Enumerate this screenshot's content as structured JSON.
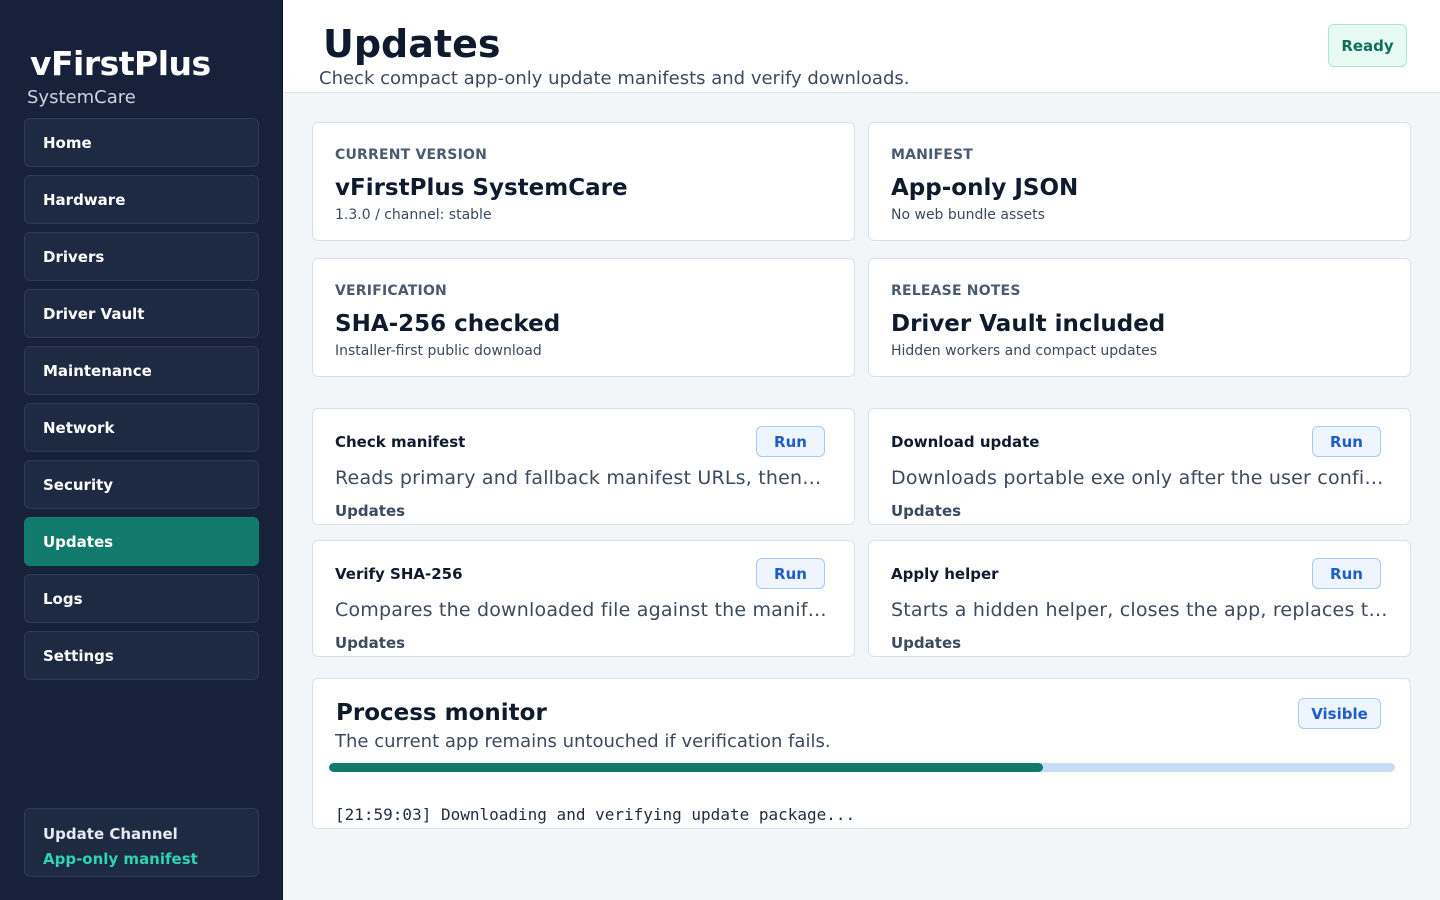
{
  "sidebar": {
    "brand": "vFirstPlus",
    "brand_sub": "SystemCare",
    "items": [
      {
        "label": "Home"
      },
      {
        "label": "Hardware"
      },
      {
        "label": "Drivers"
      },
      {
        "label": "Driver Vault"
      },
      {
        "label": "Maintenance"
      },
      {
        "label": "Network"
      },
      {
        "label": "Security"
      },
      {
        "label": "Updates"
      },
      {
        "label": "Logs"
      },
      {
        "label": "Settings"
      }
    ],
    "active_item": "Updates",
    "channel": {
      "title": "Update Channel",
      "value": "App-only manifest"
    }
  },
  "header": {
    "title": "Updates",
    "subtitle": "Check compact app-only update manifests and verify downloads.",
    "status": "Ready"
  },
  "info_cards": [
    {
      "label": "CURRENT VERSION",
      "value": "vFirstPlus SystemCare",
      "note": "1.3.0 / channel: stable"
    },
    {
      "label": "MANIFEST",
      "value": "App-only JSON",
      "note": "No web bundle assets"
    },
    {
      "label": "VERIFICATION",
      "value": "SHA-256 checked",
      "note": "Installer-first public download"
    },
    {
      "label": "RELEASE NOTES",
      "value": "Driver Vault included",
      "note": "Hidden workers and compact updates"
    }
  ],
  "tasks": [
    {
      "title": "Check manifest",
      "button": "Run",
      "description": "Reads primary and fallback manifest URLs, then…",
      "tag": "Updates"
    },
    {
      "title": "Download update",
      "button": "Run",
      "description": "Downloads portable exe only after the user confirms…",
      "tag": "Updates"
    },
    {
      "title": "Verify SHA-256",
      "button": "Run",
      "description": "Compares the downloaded file against the manifest…",
      "tag": "Updates"
    },
    {
      "title": "Apply helper",
      "button": "Run",
      "description": "Starts a hidden helper, closes the app, replaces the…",
      "tag": "Updates"
    }
  ],
  "monitor": {
    "title": "Process monitor",
    "subtitle": "The current app remains untouched if verification fails.",
    "badge": "Visible",
    "progress": 0.67,
    "log": "[21:59:03] Downloading and verifying update package..."
  },
  "colors": {
    "sidebar_bg": "#17223a",
    "accent": "#117a6c",
    "channel_accent": "#2fd3b2",
    "button_text": "#1e5cc7"
  }
}
